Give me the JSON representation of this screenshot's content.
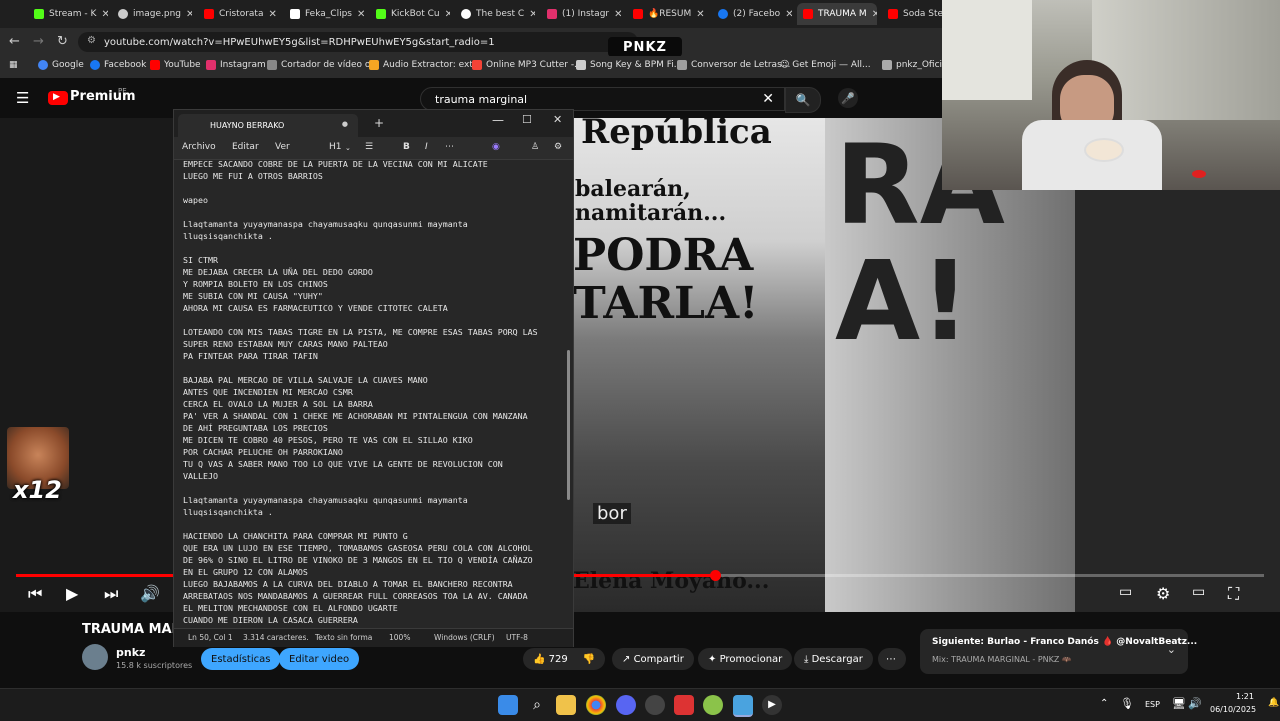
{
  "browser": {
    "tabs": [
      {
        "label": "Stream - K",
        "icon": "kick-icon",
        "color": "#53fc18"
      },
      {
        "label": "image.png",
        "icon": "globe-icon",
        "color": "#cccccc"
      },
      {
        "label": "Cristorata",
        "icon": "youtube-icon",
        "color": "#ff0000"
      },
      {
        "label": "Feka_Clips",
        "icon": "tiktok-icon",
        "color": "#ffffff"
      },
      {
        "label": "KickBot Cu",
        "icon": "kick-icon",
        "color": "#53fc18"
      },
      {
        "label": "The best C",
        "icon": "github-icon",
        "color": "#ffffff"
      },
      {
        "label": "(1) Instagr",
        "icon": "instagram-icon",
        "color": "#e1306c"
      },
      {
        "label": "🔥RESUM",
        "icon": "youtube-icon",
        "color": "#ff0000"
      },
      {
        "label": "(2) Facebo",
        "icon": "facebook-icon",
        "color": "#1877f2"
      },
      {
        "label": "TRAUMA M",
        "icon": "youtube-icon",
        "color": "#ff0000"
      },
      {
        "label": "Soda Stere",
        "icon": "youtube-icon",
        "color": "#ff0000"
      }
    ],
    "url": "youtube.com/watch?v=HPwEUhwEY5g&list=RDHPwEUhwEY5g&start_radio=1",
    "bookmarks": [
      {
        "label": "Google",
        "color": "#4285f4"
      },
      {
        "label": "Facebook",
        "color": "#1877f2"
      },
      {
        "label": "YouTube",
        "color": "#ff0000"
      },
      {
        "label": "Instagram",
        "color": "#e1306c"
      },
      {
        "label": "Cortador de vídeo o...",
        "color": "#888888"
      },
      {
        "label": "Audio Extractor: ext...",
        "color": "#f5a623"
      },
      {
        "label": "Online MP3 Cutter -...",
        "color": "#f44336"
      },
      {
        "label": "Song Key & BPM Fi...",
        "color": "#cccccc"
      },
      {
        "label": "Conversor de Letras...",
        "color": "#9e9e9e"
      },
      {
        "label": "😉 Get Emoji — All...",
        "color": "#ffcc00"
      },
      {
        "label": "pnkz_Oficial",
        "color": "#aaaaaa"
      }
    ]
  },
  "overlay_logo": "PNKZ",
  "youtube": {
    "logo": "Premium",
    "region": "PE",
    "search_value": "trauma marginal",
    "video_title": "TRAUMA MARG",
    "channel_name": "pnkz",
    "subscribers": "15.8 k suscriptores",
    "buttons": {
      "stats": "Estadísticas",
      "edit": "Editar video",
      "likes": "729",
      "share": "Compartir",
      "promote": "Promocionar",
      "download": "Descargar"
    },
    "next_label": "Siguiente: Burlao - Franco Danós 🩸 @NovaltBeatz...",
    "mix_label": "Mix: TRAUMA MARGINAL - PNKZ 🦇",
    "progress": 0.56,
    "video_overlay_text": "bor",
    "newspaper": {
      "masthead": "República",
      "line1": "balearán,",
      "line2": "namitarán...",
      "line3": "PODRA",
      "line4": "TARLA!",
      "byline": "Elena Moyano..."
    },
    "right_overlay": "RA\nA!"
  },
  "emote_count": "x12",
  "notepad": {
    "tab_title": "HUAYNO BERRAKO",
    "menus": [
      "Archivo",
      "Editar",
      "Ver"
    ],
    "heading_select": "H1",
    "text": "EMPECE SACANDO COBRE DE LA PUERTA DE LA VECINA CON MI ALICATE\nLUEGO ME FUI A OTROS BARRIOS\n\nwapeo\n\nLlaqtamanta yuyaymanaspa chayamusaqku qunqasunmi maymanta\nlluqsisqanchikta .\n\nSI CTMR\nME DEJABA CRECER LA UÑA DEL DEDO GORDO\nY ROMPIA BOLETO EN LOS CHINOS\nME SUBIA CON MI CAUSA \"YUHY\"\nAHORA MI CAUSA ES FARMACEUTICO Y VENDE CITOTEC CALETA\n\nLOTEANDO CON MIS TABAS TIGRE EN LA PISTA, ME COMPRE ESAS TABAS PORQ LAS\nSUPER RENO ESTABAN MUY CARAS MANO PALTEAO\nPA FINTEAR PARA TIRAR TAFIN\n\nBAJABA PAL MERCAO DE VILLA SALVAJE LA CUAVES MANO\nANTES QUE INCENDIEN MI MERCAO CSMR\nCERCA EL OVALO LA MUJER A SOL LA BARRA\nPA' VER A SHANDAL CON 1 CHEKE ME ACHORABAN MI PINTALENGUA CON MANZANA\nDE AHÍ PREGUNTABA LOS PRECIOS\nME DICEN TE COBRO 40 PESOS, PERO TE VAS CON EL SILLAO KIKO\nPOR CACHAR PELUCHE OH PARROKIANO\nTU Q VAS A SABER MANO TOO LO QUE VIVE LA GENTE DE REVOLUCION CON\nVALLEJO\n\nLlaqtamanta yuyaymanaspa chayamusaqku qunqasunmi maymanta\nlluqsisqanchikta .\n\nHACIENDO LA CHANCHITA PARA COMPRAR MI PUNTO G\nQUE ERA UN LUJO EN ESE TIEMPO, TOMABAMOS GASEOSA PERU COLA CON ALCOHOL\nDE 96% O SINO EL LITRO DE VINOKO DE 3 MANGOS EN EL TIO Q VENDÍA CAÑAZO\nEN EL GRUPO 12 CON ALAMOS\nLUEGO BAJABAMOS A LA CURVA DEL DIABLO A TOMAR EL BANCHERO RECONTRA\nARREBATAOS NOS MANDABAMOS A GUERREAR FULL CORREASOS TOA LA AV. CANADA\nEL MELITON MECHANDOSE CON EL ALFONDO UGARTE\nCUANDO ME DIERON LA CASACA GUERRERA",
    "status": {
      "position": "Ln 50, Col 1",
      "chars": "3.314 caracteres.",
      "format": "Texto sin forma",
      "zoom": "100%",
      "eol": "Windows (CRLF)",
      "encoding": "UTF-8"
    }
  },
  "taskbar": {
    "lang": "ESP",
    "time": "1:21",
    "date": "06/10/2025"
  }
}
